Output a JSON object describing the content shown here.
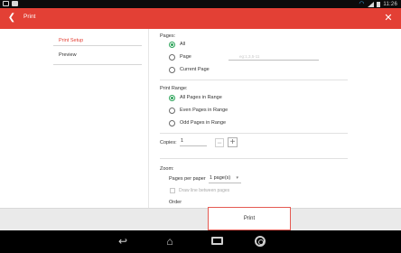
{
  "status_bar": {
    "time": "11:26",
    "icons": [
      "notification-icon",
      "usb-icon",
      "wifi-icon",
      "signal-icon",
      "battery-icon"
    ]
  },
  "app_bar": {
    "title": "Print",
    "back_icon": "back-arrow-icon",
    "close_icon": "close-icon",
    "color": "#e34035"
  },
  "sidebar": {
    "items": [
      {
        "label": "Print Setup",
        "active": true
      },
      {
        "label": "Preview",
        "active": false
      }
    ]
  },
  "pages": {
    "label": "Pages:",
    "options": [
      {
        "label": "All",
        "checked": true
      },
      {
        "label": "Page",
        "checked": false
      },
      {
        "label": "Current Page",
        "checked": false
      }
    ],
    "page_input_placeholder": "eg:1,3,5-11"
  },
  "print_range": {
    "label": "Print Range:",
    "options": [
      {
        "label": "All Pages in Range",
        "checked": true
      },
      {
        "label": "Even Pages in Range",
        "checked": false
      },
      {
        "label": "Odd Pages in Range",
        "checked": false
      }
    ]
  },
  "copies": {
    "label": "Copies:",
    "value": "1",
    "minus": "−",
    "plus": "+"
  },
  "zoom": {
    "label": "Zoom:",
    "pages_per_paper_label": "Pages per paper",
    "pages_per_paper_value": "1 page(s)",
    "draw_line_label": "Draw line between pages",
    "draw_line_checked": false,
    "order_label": "Order"
  },
  "footer": {
    "print_label": "Print"
  },
  "nav_bar": {
    "icons": [
      "back-icon",
      "home-icon",
      "recent-apps-icon",
      "chrome-icon"
    ]
  },
  "colors": {
    "accent": "#e34035",
    "radio_checked": "#2da45a"
  }
}
